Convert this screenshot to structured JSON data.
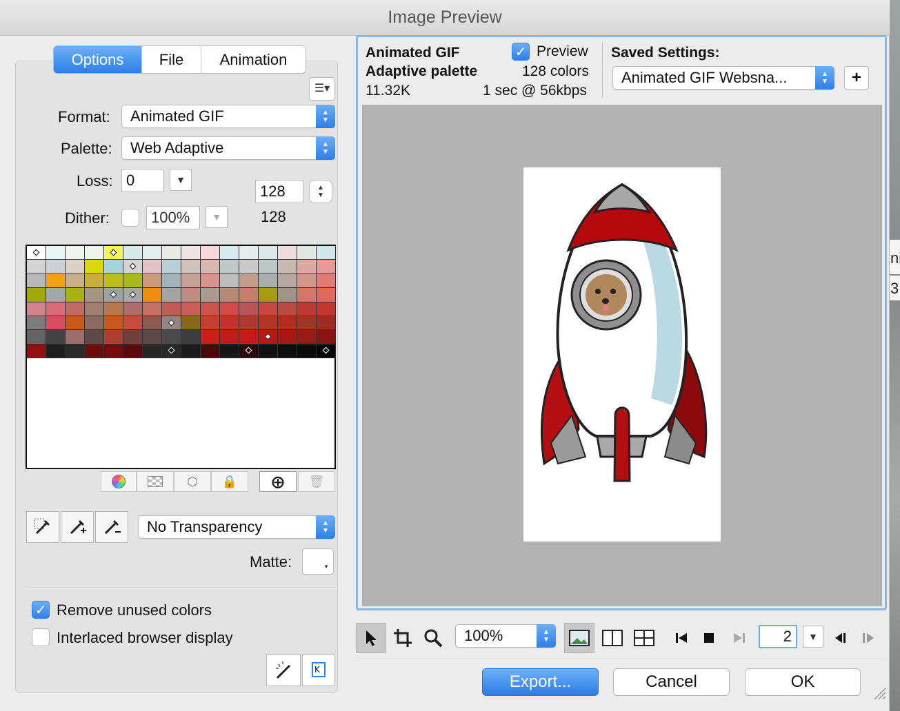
{
  "window": {
    "title": "Image Preview"
  },
  "tabs": [
    {
      "label": "Options",
      "active": true
    },
    {
      "label": "File",
      "active": false
    },
    {
      "label": "Animation",
      "active": false
    }
  ],
  "options": {
    "format_label": "Format:",
    "format_value": "Animated GIF",
    "palette_label": "Palette:",
    "palette_value": "Web Adaptive",
    "loss_label": "Loss:",
    "loss_value": "0",
    "colors_value": "128",
    "colors_count": "128",
    "dither_label": "Dither:",
    "dither_checked": false,
    "dither_value": "100%"
  },
  "palette_swatches": [
    "#ffffff",
    "#e8f6f6",
    "#f0f4ee",
    "#edf3ef",
    "#f5f55a",
    "#d6eaea",
    "#e3eeee",
    "#eaeae4",
    "#f1e4e4",
    "#f7d8dc",
    "#d7ecef",
    "#e4eeee",
    "#dde8e8",
    "#ecdede",
    "#e1e8e4",
    "#cfe7e8",
    "#d3d3d3",
    "#cbd0d6",
    "#ddd0c6",
    "#d9d80f",
    "#a9d3dc",
    "#d4d4d4",
    "#e2c2c2",
    "#b8cfd5",
    "#d0c2b9",
    "#d7b7ad",
    "#bfc7c9",
    "#c9c9c9",
    "#bcc6c7",
    "#c6b9b4",
    "#dba9a2",
    "#e69995",
    "#b9b9b9",
    "#f0a315",
    "#c9b08a",
    "#c7b03d",
    "#bfbe1b",
    "#a7b81d",
    "#ca9b7a",
    "#a3b3b7",
    "#c9a297",
    "#d7958e",
    "#bdbdbd",
    "#c39d8b",
    "#a9aeaf",
    "#b8a6a0",
    "#d2988c",
    "#e27a76",
    "#a3a809",
    "#9fa9a9",
    "#a9b114",
    "#a69582",
    "#9aa2a2",
    "#a7a7a7",
    "#f08e12",
    "#a3a3a3",
    "#bd8d83",
    "#ab9a8f",
    "#b68a74",
    "#c47c6c",
    "#a99a16",
    "#9f938a",
    "#d8756a",
    "#e2675f",
    "#d3868a",
    "#d86b76",
    "#c06b66",
    "#a27f73",
    "#b7774f",
    "#ad6e6a",
    "#c27366",
    "#c25a55",
    "#cd5d59",
    "#c9544e",
    "#d24947",
    "#b85555",
    "#c94643",
    "#ba4a42",
    "#bd3b33",
    "#c43630",
    "#7d7d7d",
    "#d94d60",
    "#c5581a",
    "#8a6a63",
    "#c9561a",
    "#c94b3c",
    "#8f5b50",
    "#948681",
    "#88661c",
    "#c43f31",
    "#c5302d",
    "#ad3830",
    "#b23528",
    "#b52a21",
    "#a0332b",
    "#9f2d25",
    "#636363",
    "#434343",
    "#9d6f6c",
    "#5e4a48",
    "#ad3f33",
    "#70403b",
    "#5c4a48",
    "#4a4a4a",
    "#3c3c3c",
    "#cc1e1a",
    "#c21b1b",
    "#c81a1a",
    "#bb1515",
    "#aa1616",
    "#991a19",
    "#8a1414",
    "#930f0f",
    "#1f1f1f",
    "#2a2a2a",
    "#6d0b0b",
    "#7a0a0a",
    "#5a0a0a",
    "#262626",
    "#282828",
    "#1b1b1b",
    "#4a0a0a",
    "#161616",
    "#2b0707",
    "#121212",
    "#0e0e0e",
    "#0a0a0a",
    "#050505"
  ],
  "palette_marked_indices": [
    0,
    4,
    21,
    52,
    53,
    87,
    108,
    119,
    123,
    127
  ],
  "palette_buttons": [
    "color-wheel-icon",
    "transparency-icon",
    "web-snap-icon",
    "lock-icon",
    "add-color-icon",
    "trash-icon"
  ],
  "transparency": {
    "value": "No Transparency",
    "matte_label": "Matte:"
  },
  "checks": {
    "remove_unused": {
      "label": "Remove unused colors",
      "checked": true
    },
    "interlaced": {
      "label": "Interlaced browser display",
      "checked": false
    }
  },
  "preview": {
    "format": "Animated GIF",
    "palette": "Adaptive palette",
    "size": "11.32K",
    "preview_label": "Preview",
    "preview_checked": true,
    "colors": "128 colors",
    "timing": "1 sec @ 56kbps",
    "saved_settings_label": "Saved Settings:",
    "saved_settings_value": "Animated GIF Websna...",
    "add_label": "+"
  },
  "toolbar": {
    "zoom": "100%",
    "frame": "2"
  },
  "buttons": {
    "export": "Export...",
    "cancel": "Cancel",
    "ok": "OK"
  },
  "background_window": {
    "fragment_1": "ni",
    "fragment_2": "3"
  },
  "colors": {
    "accent": "#2f7fe8",
    "focus_ring": "#8ab6ea",
    "canvas": "#b2b2b2"
  }
}
